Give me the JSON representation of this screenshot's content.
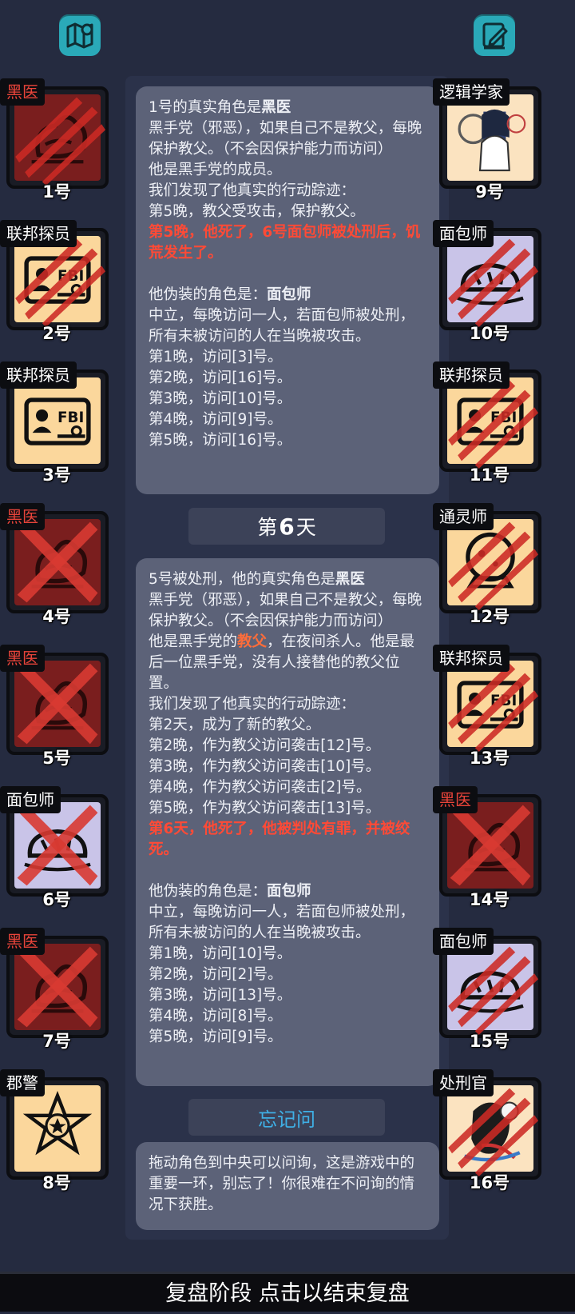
{
  "top_icons": [
    {
      "name": "map-icon"
    },
    {
      "name": "notebook-pen-icon"
    }
  ],
  "players_left": [
    {
      "num": "1号",
      "role": "黑医",
      "role_red": true,
      "mark": "claw",
      "art": "doctor"
    },
    {
      "num": "2号",
      "role": "联邦探员",
      "role_red": false,
      "mark": "claw",
      "art": "fbi"
    },
    {
      "num": "3号",
      "role": "联邦探员",
      "role_red": false,
      "mark": "none",
      "art": "fbi"
    },
    {
      "num": "4号",
      "role": "黑医",
      "role_red": true,
      "mark": "cross",
      "art": "doctor"
    },
    {
      "num": "5号",
      "role": "黑医",
      "role_red": true,
      "mark": "cross",
      "art": "doctor"
    },
    {
      "num": "6号",
      "role": "面包师",
      "role_red": false,
      "mark": "cross",
      "art": "bread"
    },
    {
      "num": "7号",
      "role": "黑医",
      "role_red": true,
      "mark": "cross",
      "art": "doctor"
    },
    {
      "num": "8号",
      "role": "郡警",
      "role_red": false,
      "mark": "none",
      "art": "sheriff"
    }
  ],
  "players_right": [
    {
      "num": "9号",
      "role": "逻辑学家",
      "role_red": false,
      "mark": "none",
      "art": "logician"
    },
    {
      "num": "10号",
      "role": "面包师",
      "role_red": false,
      "mark": "claw",
      "art": "bread"
    },
    {
      "num": "11号",
      "role": "联邦探员",
      "role_red": false,
      "mark": "claw",
      "art": "fbi"
    },
    {
      "num": "12号",
      "role": "通灵师",
      "role_red": false,
      "mark": "claw",
      "art": "medium"
    },
    {
      "num": "13号",
      "role": "联邦探员",
      "role_red": false,
      "mark": "claw",
      "art": "fbi"
    },
    {
      "num": "14号",
      "role": "黑医",
      "role_red": true,
      "mark": "cross",
      "art": "doctor"
    },
    {
      "num": "15号",
      "role": "面包师",
      "role_red": false,
      "mark": "claw",
      "art": "bread"
    },
    {
      "num": "16号",
      "role": "处刑官",
      "role_red": false,
      "mark": "claw",
      "art": "executioner"
    }
  ],
  "card1": {
    "l1a": "1号的真实角色是",
    "l1b": "黑医",
    "l2": "黑手党（邪恶），如果自己不是教父，每晚保护教父。（不会因保护能力而访问）",
    "l3": "他是黑手党的成员。",
    "l4": "我们发现了他真实的行动踪迹：",
    "l5": "第5晚，教父受攻击，保护教父。",
    "l6": "第5晚，他死了，6号面包师被处刑后，饥荒发生了。",
    "l7a": "他伪装的角色是：",
    "l7b": "面包师",
    "l8": "中立，每晚访问一人，若面包师被处刑，所有未被访问的人在当晚被攻击。",
    "visits": [
      "第1晚，访问[3]号。",
      "第2晚，访问[16]号。",
      "第3晚，访问[10]号。",
      "第4晚，访问[9]号。",
      "第5晚，访问[16]号。"
    ]
  },
  "day_header": {
    "pre": "第",
    "num": "6",
    "post": "天"
  },
  "card2": {
    "l1a": "5号被处刑，他的真实角色是",
    "l1b": "黑医",
    "l2": "黑手党（邪恶），如果自己不是教父，每晚保护教父。（不会因保护能力而访问）",
    "l3a": "他是黑手党的",
    "l3b": "教父",
    "l3c": "，在夜间杀人。他是最后一位黑手党，没有人接替他的教父位置。",
    "l4": "我们发现了他真实的行动踪迹：",
    "actions": [
      "第2天，成为了新的教父。",
      "第2晚，作为教父访问袭击[12]号。",
      "第3晚，作为教父访问袭击[10]号。",
      "第4晚，作为教父访问袭击[2]号。",
      "第5晚，作为教父访问袭击[13]号。"
    ],
    "death": "第6天，他死了，他被判处有罪，并被绞死。",
    "l7a": "他伪装的角色是：",
    "l7b": "面包师",
    "l8": "中立，每晚访问一人，若面包师被处刑，所有未被访问的人在当晚被攻击。",
    "visits": [
      "第1晚，访问[10]号。",
      "第2晚，访问[2]号。",
      "第3晚，访问[13]号。",
      "第4晚，访问[8]号。",
      "第5晚，访问[9]号。"
    ]
  },
  "forget_header": "忘记问",
  "card3": {
    "text": "拖动角色到中央可以问询，这是游戏中的重要一环，别忘了！你很难在不问询的情况下获胜。"
  },
  "bottom_bar": "复盘阶段 点击以结束复盘",
  "colors": {
    "bg": "#252b40",
    "card": "#5c6278",
    "red_text": "#ff4a36",
    "teal": "#2aa9b8",
    "forget": "#3fb0e6"
  }
}
